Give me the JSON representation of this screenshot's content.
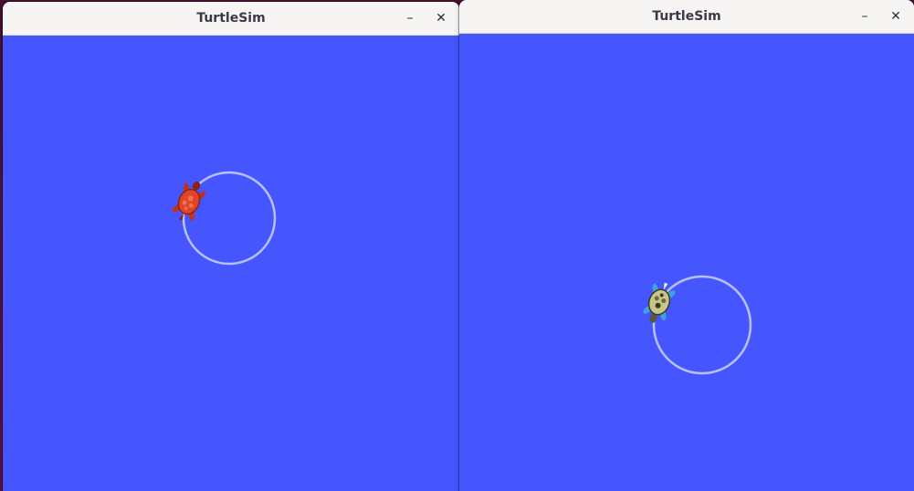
{
  "windows": [
    {
      "title": "TurtleSim",
      "minimize_label": "–",
      "close_label": "✕",
      "background": "#4556ff",
      "turtle_color": "#e2442a"
    },
    {
      "title": "TurtleSim",
      "minimize_label": "–",
      "close_label": "✕",
      "background": "#4556ff",
      "turtle_color": "#c9c48a"
    }
  ],
  "trail_color": "#b8c1ff"
}
